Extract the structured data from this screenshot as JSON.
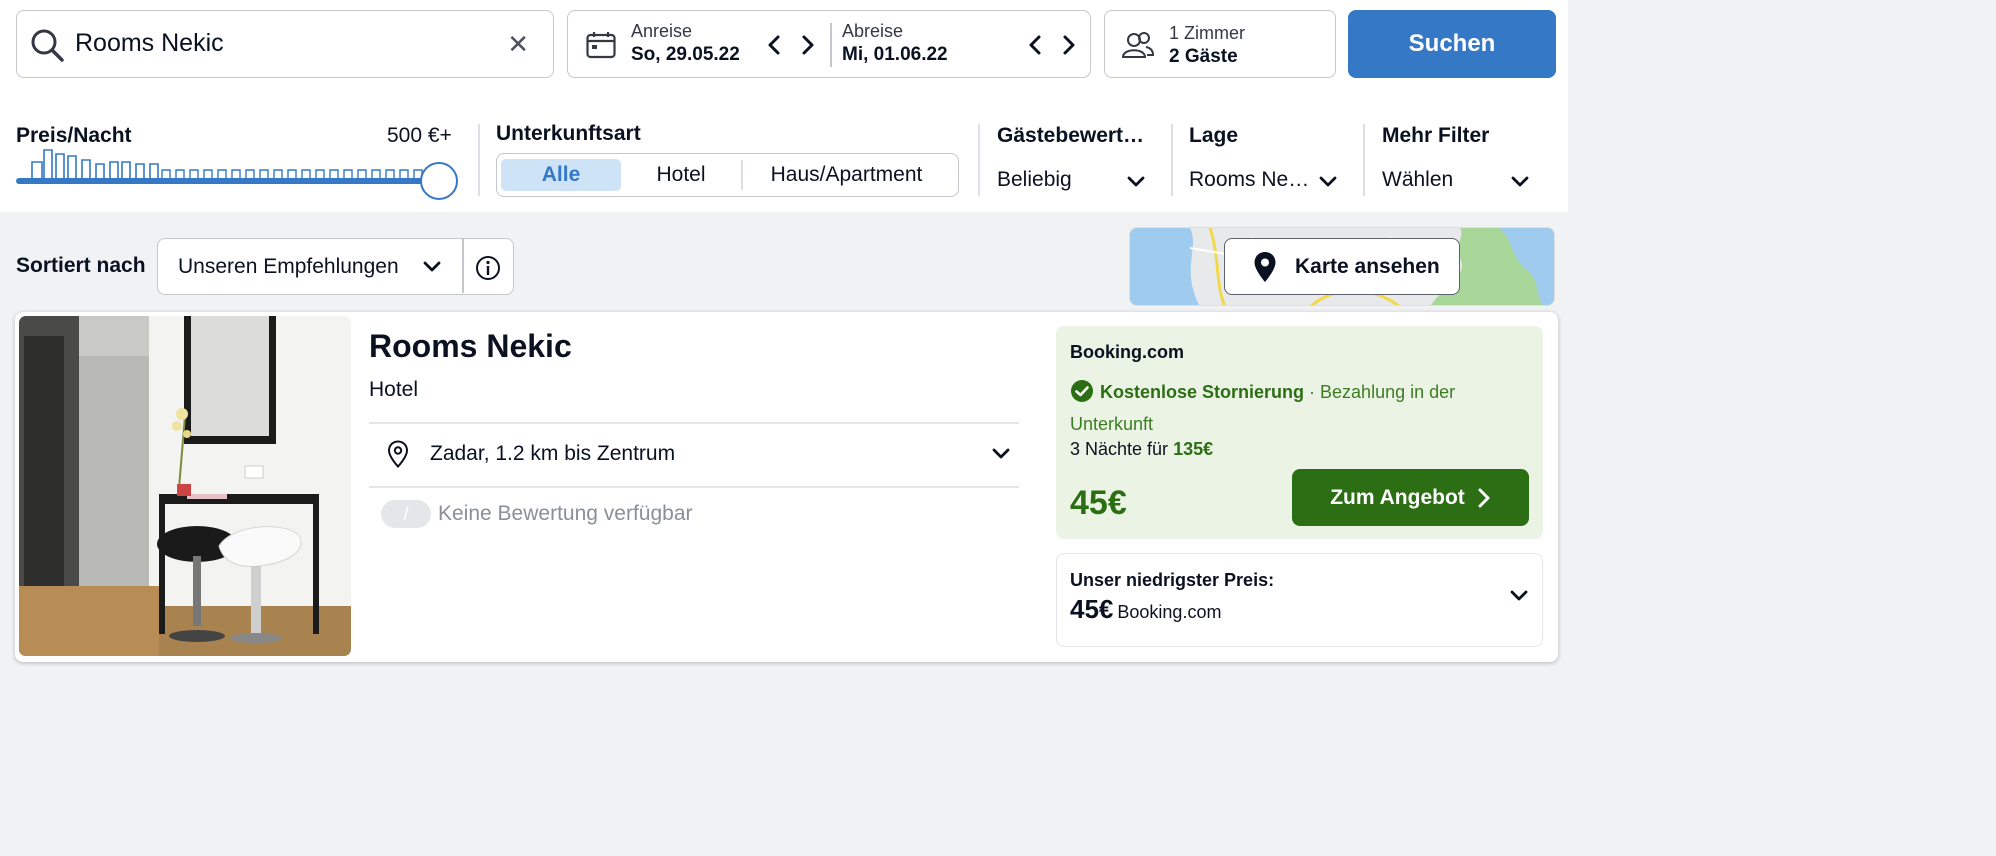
{
  "search": {
    "query": "Rooms Nekic"
  },
  "dates": {
    "checkin_label": "Anreise",
    "checkin_value": "So, 29.05.22",
    "checkout_label": "Abreise",
    "checkout_value": "Mi, 01.06.22"
  },
  "guests": {
    "rooms": "1 Zimmer",
    "guests": "2 Gäste"
  },
  "search_button": "Suchen",
  "filters": {
    "price_title": "Preis/Nacht",
    "price_max": "500 €+",
    "type_title": "Unterkunftsart",
    "type_options": [
      "Alle",
      "Hotel",
      "Haus/Apartment"
    ],
    "rating_title": "Gästebewert…",
    "rating_value": "Beliebig",
    "location_title": "Lage",
    "location_value": "Rooms Ne…",
    "more_title": "Mehr Filter",
    "more_value": "Wählen"
  },
  "sort": {
    "label": "Sortiert nach",
    "value": "Unseren Empfehlungen"
  },
  "map": {
    "button": "Karte ansehen"
  },
  "result": {
    "name": "Rooms Nekic",
    "type": "Hotel",
    "location": "Zadar, 1.2 km bis Zentrum",
    "rating_badge": "/",
    "rating_text": "Keine Bewertung verfügbar",
    "deal": {
      "provider": "Booking.com",
      "cancel_strong": "Kostenlose Stornierung",
      "cancel_rest": " · Bezahlung in der Unterkunft",
      "nights_prefix": "3 Nächte für ",
      "nights_total": "135€",
      "price": "45€",
      "button": "Zum Angebot"
    },
    "lowest": {
      "label": "Unser niedrigster Preis:",
      "price": "45€",
      "provider": "Booking.com"
    }
  },
  "colors": {
    "primary": "#3478c6",
    "deal_green": "#2c6e14",
    "deal_bg": "#ebf4e4"
  }
}
